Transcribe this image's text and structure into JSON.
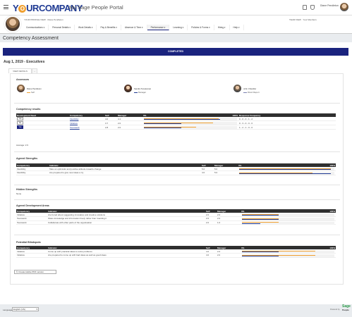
{
  "header": {
    "logo_part1": "Y",
    "logo_o": "O",
    "logo_part2": "URCOMPANY",
    "portal_title": "My Sage People Portal",
    "user_name": "Diane Pendleton"
  },
  "subheader": {
    "view_text": "YOUR PROFILE VIEW · Diane Pendleton",
    "team_view": "TEAM VIEW",
    "your_members": "Your Members"
  },
  "tabs": [
    {
      "label": "Communications"
    },
    {
      "label": "Personal Details"
    },
    {
      "label": "Work Details"
    },
    {
      "label": "Pay & Benefits"
    },
    {
      "label": "Absence & Time"
    },
    {
      "label": "Performance"
    },
    {
      "label": "Learning"
    },
    {
      "label": "Policies & Forms"
    },
    {
      "label": "Hiring"
    },
    {
      "label": "Help"
    }
  ],
  "page": {
    "title": "Competency Assessment",
    "status_banner": "COMPLETED",
    "period": "Aug 1, 2019 - Executives",
    "panel_tab": "VIEW DETAILS",
    "panel_tab2": "..."
  },
  "assessors": {
    "heading": "Assessors",
    "people": [
      {
        "name": "Diane Pendleton",
        "role": "Self",
        "color": "#f0a030"
      },
      {
        "name": "Sandra Templeman",
        "role": "Manager",
        "color": "#1f3a93"
      },
      {
        "name": "John Chandler",
        "role": "Direct Report",
        "color": "#7a7fb0"
      }
    ]
  },
  "competency_results": {
    "heading": "Competency results",
    "columns": [
      "Development Need",
      "Competency",
      "Self",
      "Manager",
      "0%",
      "100%",
      "Response Frequency"
    ],
    "rows": [
      {
        "need": "Yes",
        "competency": "Flexibility",
        "self": "4.0",
        "manager": "4.1",
        "freq": "0 - 0 - 0 - 1 - 2",
        "self_pct": 0.8,
        "mgr_pct": 0.82,
        "need_selected": false
      },
      {
        "need": "No",
        "competency": "Initiative",
        "self": "3.7",
        "manager": "2.0",
        "freq": "0 - 3 - 0 - 0 - 0",
        "self_pct": 0.74,
        "mgr_pct": 0.4,
        "need_selected": false
      },
      {
        "need": "Yes",
        "competency": "Teamwork",
        "self": "2.8",
        "manager": "2.0",
        "freq": "1 - 2 - 1 - 0 - 0",
        "self_pct": 0.56,
        "mgr_pct": 0.4,
        "need_selected": true
      }
    ],
    "average_label": "Average:",
    "average_value": "2.9"
  },
  "agreed_strengths": {
    "heading": "Agreed Strengths",
    "columns": [
      "Competency",
      "Indicator",
      "Self",
      "Manager",
      "0%",
      "100%"
    ],
    "rows": [
      {
        "competency": "Flexibility",
        "indicator": "Take an optimistic and positive attitude towards change",
        "self": "5.0",
        "manager": "5.0",
        "self_pct": 1.0,
        "mgr_pct": 1.0
      },
      {
        "competency": "Flexibility",
        "indicator": "Are prepared to give new ideas a try",
        "self": "4.0",
        "manager": "5.0",
        "self_pct": 0.8,
        "mgr_pct": 1.0
      }
    ]
  },
  "hidden_strengths": {
    "heading": "Hidden Strengths",
    "value": "None"
  },
  "agreed_dev_areas": {
    "heading": "Agreed Development Areas",
    "columns": [
      "Competency",
      "Indicator",
      "Self",
      "Manager",
      "0%",
      "100%"
    ],
    "rows": [
      {
        "competency": "Initiative",
        "indicator": "Are bored about suggesting innovative and creative solutions",
        "self": "2.0",
        "manager": "2.0",
        "self_pct": 0.4,
        "mgr_pct": 0.4
      },
      {
        "competency": "Teamwork",
        "indicator": "Share knowledge and information freely rather than hoarding it",
        "self": "2.0",
        "manager": "2.0",
        "self_pct": 0.4,
        "mgr_pct": 0.4
      },
      {
        "competency": "Teamwork",
        "indicator": "Collaborate with other parts of the organisation",
        "self": "2.0",
        "manager": "1.0",
        "self_pct": 0.4,
        "mgr_pct": 0.2
      }
    ]
  },
  "potential_blindspots": {
    "heading": "Potential Blindspots",
    "columns": [
      "Competency",
      "Indicator",
      "Self",
      "Manager",
      "0%",
      "100%"
    ],
    "rows": [
      {
        "competency": "Initiative",
        "indicator": "Come up with practical ideas to solve problems",
        "self": "4.0",
        "manager": "2.0",
        "self_pct": 0.8,
        "mgr_pct": 0.4
      },
      {
        "competency": "Initiative",
        "indicator": "Are prepared to come up with bad ideas as well as good ideas",
        "self": "4.0",
        "manager": "2.0",
        "self_pct": 0.8,
        "mgr_pct": 0.4
      }
    ]
  },
  "actions": {
    "pdf_button": "Create Adobe PDF version"
  },
  "footer": {
    "language_label": "Language",
    "language_value": "English (US)",
    "powered_by": "Powered by",
    "brand": "Sage",
    "brand2": "People"
  },
  "colors": {
    "self": "#f0a030",
    "manager": "#1f3a93",
    "banner": "#1a237e"
  }
}
